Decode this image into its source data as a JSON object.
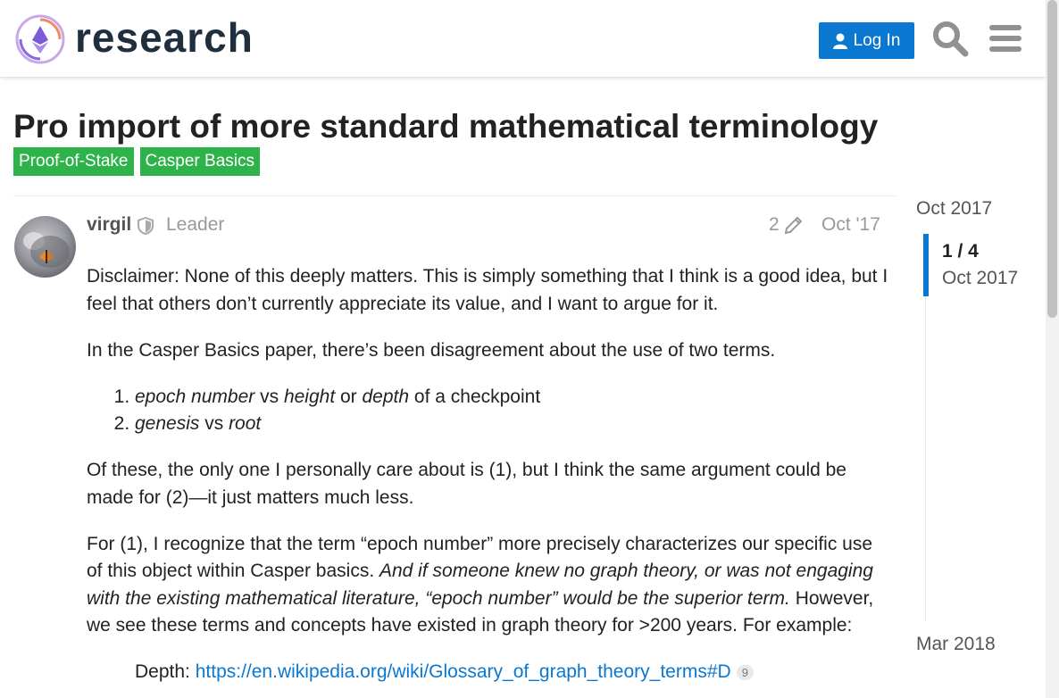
{
  "header": {
    "brand": "research",
    "login_label": "Log In"
  },
  "topic": {
    "title": "Pro import of more standard mathematical terminology",
    "tags": [
      "Proof-of-Stake",
      "Casper Basics"
    ]
  },
  "post": {
    "username": "virgil",
    "user_title": "Leader",
    "edit_count": "2",
    "date": "Oct '17",
    "p1": "Disclaimer: None of this deeply matters. This is simply something that I think is a good idea, but I feel that others don’t currently appreciate its value, and I want to argue for it.",
    "p2": "In the Casper Basics paper, there’s been disagreement about the use of two terms.",
    "list": [
      {
        "a": "epoch number",
        "sep1": " vs ",
        "b": "height",
        "sep2": " or ",
        "c": "depth",
        "tail": " of a checkpoint"
      },
      {
        "a": "genesis",
        "sep1": " vs ",
        "b": "root"
      }
    ],
    "p3": "Of these, the only one I personally care about is (1), but I think the same argument could be made for (2)—it just matters much less.",
    "p4_a": "For (1), I recognize that the term “epoch number” more precisely characterizes our specific use of this object within Casper basics. ",
    "p4_b": "And if someone knew no graph theory, or was not engaging with the existing mathematical literature, “epoch number” would be the superior term.",
    "p4_c": " However, we see these terms and concepts have existed in graph theory for >200 years. For example:",
    "depth_label": "Depth: ",
    "depth_link": "https://en.wikipedia.org/wiki/Glossary_of_graph_theory_terms#D",
    "depth_clicks": "9"
  },
  "timeline": {
    "start": "Oct 2017",
    "position": "1 / 4",
    "current_date": "Oct 2017",
    "end": "Mar 2018"
  },
  "colors": {
    "accent": "#0a78d1",
    "tag": "#2eb34a"
  }
}
